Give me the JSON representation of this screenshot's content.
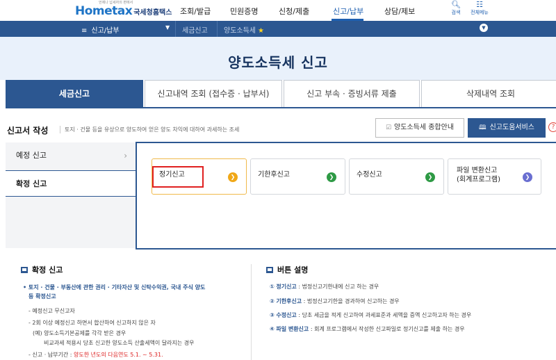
{
  "logo": {
    "tagline": "언제나 납세자의 편에서",
    "brand": "Hometax",
    "org": "국세청홈택스"
  },
  "topmenu": [
    {
      "label": "조회/발급"
    },
    {
      "label": "민원증명"
    },
    {
      "label": "신청/제출"
    },
    {
      "label": "신고/납부"
    },
    {
      "label": "상담/제보"
    }
  ],
  "util": {
    "search": "검색",
    "all_menu": "전체메뉴"
  },
  "breadcrumb": {
    "home": "신고/납부",
    "level2": "세금신고",
    "level3": "양도소득세"
  },
  "hero_title": "양도소득세 신고",
  "tabs": [
    {
      "label": "세금신고",
      "active": true
    },
    {
      "label": "신고내역 조회 (접수증 · 납부서)",
      "active": false
    },
    {
      "label": "신고 부속 · 증빙서류 제출",
      "active": false
    },
    {
      "label": "삭제내역 조회",
      "active": false
    }
  ],
  "section": {
    "title": "신고서 작성",
    "desc": "토지 · 건물 등을 유상으로 양도하여 얻은 양도 차익에 대하여 과세하는 조세",
    "guide_btn": "양도소득세 종합안내",
    "help_btn": "신고도움서비스",
    "help_q": "?"
  },
  "sidenav": [
    {
      "label": "예정 신고",
      "active": false
    },
    {
      "label": "확정 신고",
      "active": true
    }
  ],
  "cards": [
    {
      "label": "정기신고",
      "color": "#f0a818"
    },
    {
      "label": "기한후신고",
      "color": "#2e9a45"
    },
    {
      "label": "수정신고",
      "color": "#2e9a45"
    },
    {
      "label_line1": "파일 변환신고",
      "label_line2": "(회계프로그램)",
      "color": "#6a6fd1"
    }
  ],
  "confirm_info": {
    "title": "확정 신고",
    "bullet": "• 토지 · 건물 · 부동산에 관한 권리 · 기타자산 및 신탁수익권, 국내 주식 양도",
    "bullet2": "등 확정신고",
    "lines": [
      "- 예정신고 무신고자",
      "- 2회 이상 예정신고 하면서 합산하여 신고하지 않은 자",
      "(예) 양도소득기본공제를 각각 받은 경우",
      "비교과세 적용시 당초 신고한 양도소득 산출세액이 달라지는 경우"
    ],
    "period_label": "- 신고 · 납부기간 : ",
    "period_value": "양도한 년도의 다음연도 5.1. ~ 5.31."
  },
  "button_info": {
    "title": "버튼 설명",
    "items": [
      {
        "num": "①",
        "name": "정기신고",
        "desc": " : 법정신고기한내에 신고 하는 경우"
      },
      {
        "num": "②",
        "name": "기한후신고",
        "desc": " : 법정신고기한을 경과하여 신고하는 경우"
      },
      {
        "num": "③",
        "name": "수정신고",
        "desc": " : 당초 세금을 적게 신고하여 과세표준과 세액을 증액 신고하고자 하는 경우"
      },
      {
        "num": "④",
        "name": "파일 변환신고",
        "desc": " : 회계 프로그램에서 작성한 신고파일로 정기신고를  제출 하는 경우"
      }
    ]
  }
}
